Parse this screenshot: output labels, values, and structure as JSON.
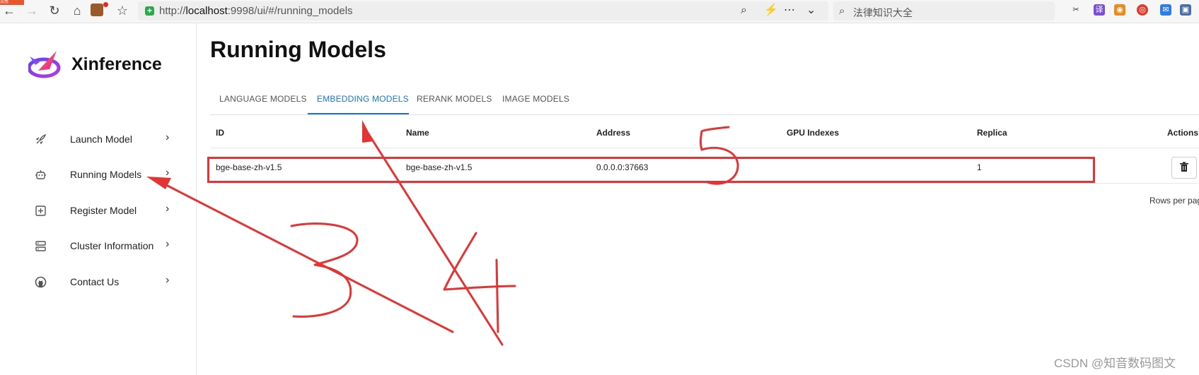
{
  "browser": {
    "corner_tag": "灵感",
    "url_prefix": "http://",
    "url_host": "localhost",
    "url_rest": ":9998/ui/#/running_models",
    "search_text": "法律知识大全",
    "ext_label": "译"
  },
  "sidebar": {
    "app_name": "Xinference",
    "items": [
      {
        "label": "Launch Model",
        "icon": "rocket-icon"
      },
      {
        "label": "Running Models",
        "icon": "robot-icon"
      },
      {
        "label": "Register Model",
        "icon": "add-box-icon"
      },
      {
        "label": "Cluster Information",
        "icon": "server-icon"
      },
      {
        "label": "Contact Us",
        "icon": "github-icon"
      }
    ]
  },
  "main": {
    "title": "Running Models",
    "tabs": [
      {
        "label": "LANGUAGE MODELS",
        "active": false
      },
      {
        "label": "EMBEDDING MODELS",
        "active": true
      },
      {
        "label": "RERANK MODELS",
        "active": false
      },
      {
        "label": "IMAGE MODELS",
        "active": false
      }
    ],
    "table": {
      "headers": [
        "ID",
        "Name",
        "Address",
        "GPU Indexes",
        "Replica",
        "Actions"
      ],
      "rows": [
        {
          "id": "bge-base-zh-v1.5",
          "name": "bge-base-zh-v1.5",
          "address": "0.0.0.0:37663",
          "gpu_indexes": "",
          "replica": "1"
        }
      ]
    },
    "pagination": {
      "rows_per_page_label": "Rows per page"
    }
  },
  "watermark": "CSDN @知音数码图文",
  "colors": {
    "accent": "#1976d2",
    "annotation": "#e53333"
  }
}
